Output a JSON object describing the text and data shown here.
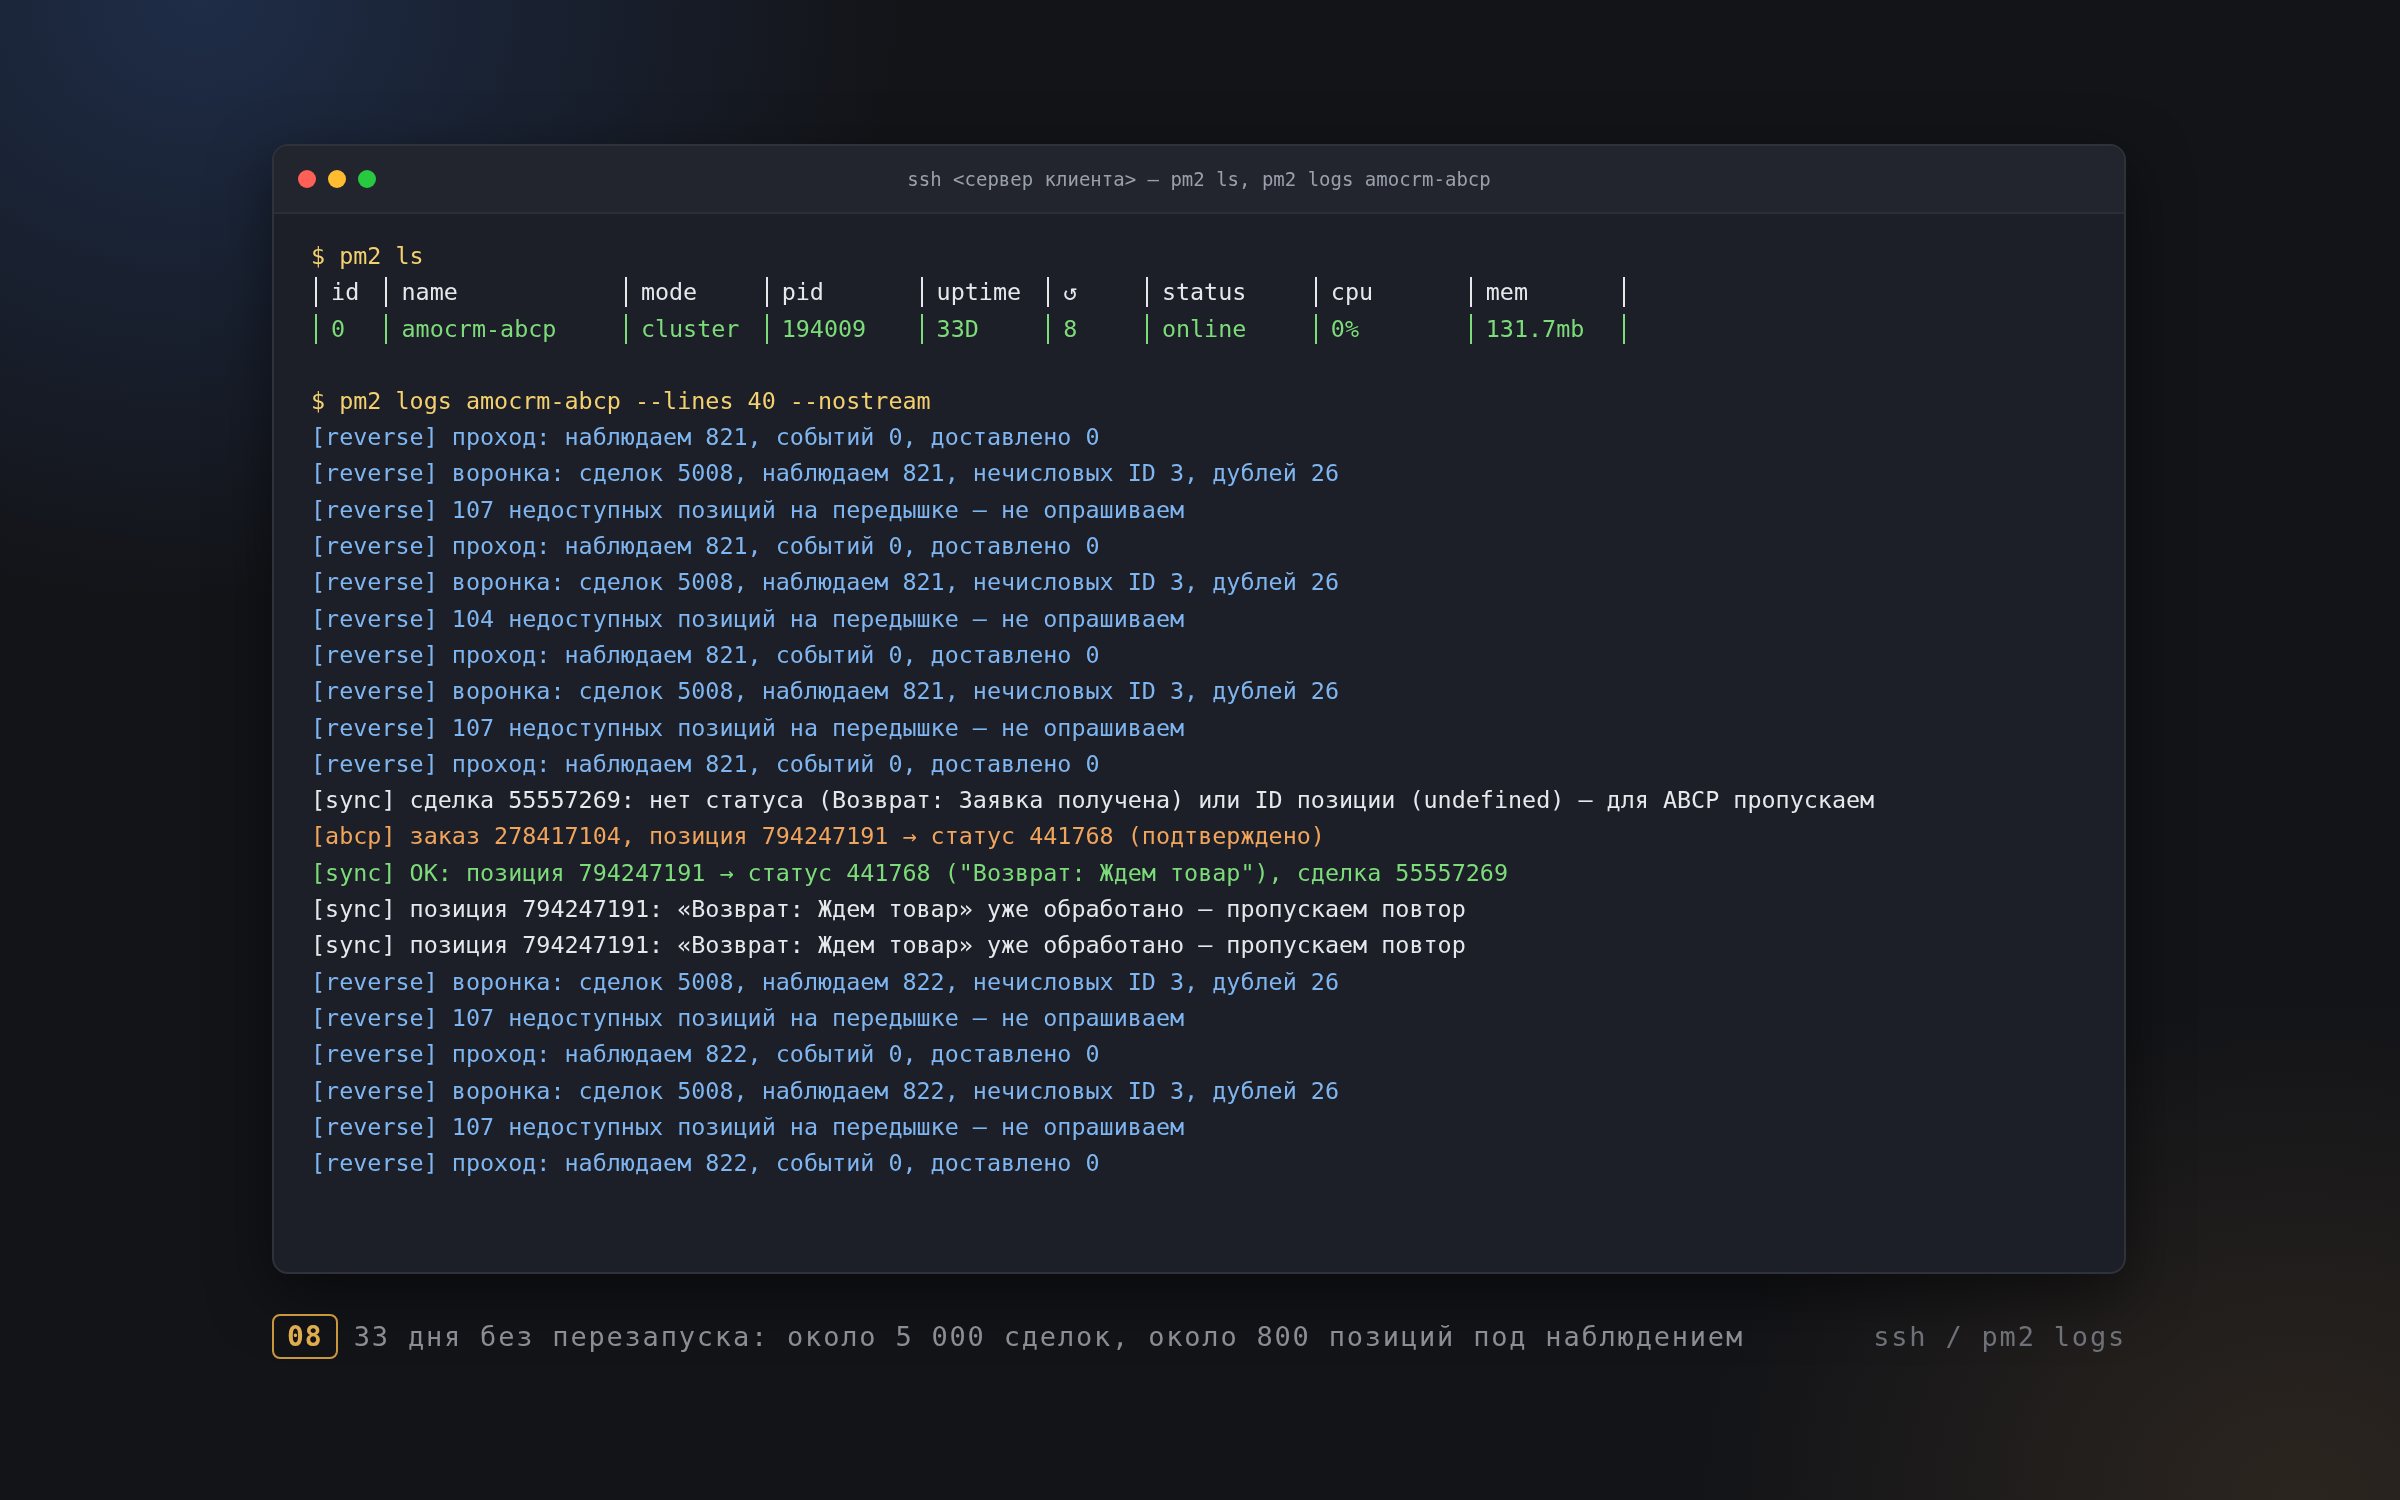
{
  "window": {
    "title": "ssh <сервер клиента> — pm2 ls, pm2 logs amocrm-abcp"
  },
  "terminal": {
    "blocks": [
      {
        "command": "$ pm2 ls",
        "table": {
          "columns": [
            "id",
            "name",
            "mode",
            "pid",
            "uptime",
            "↺",
            "status",
            "cpu",
            "mem"
          ],
          "rows": [
            [
              "0",
              "amocrm-abcp",
              "cluster",
              "194009",
              "33D",
              "8",
              "online",
              "0%",
              "131.7mb"
            ]
          ]
        }
      },
      {
        "command": "$ pm2 logs amocrm-abcp --lines 40 --nostream",
        "logs": [
          {
            "kind": "info",
            "text": "[reverse] проход: наблюдаем 821, событий 0, доставлено 0"
          },
          {
            "kind": "info",
            "text": "[reverse] воронка: сделок 5008, наблюдаем 821, нечисловых ID 3, дублей 26"
          },
          {
            "kind": "info",
            "text": "[reverse] 107 недоступных позиций на передышке — не опрашиваем"
          },
          {
            "kind": "info",
            "text": "[reverse] проход: наблюдаем 821, событий 0, доставлено 0"
          },
          {
            "kind": "info",
            "text": "[reverse] воронка: сделок 5008, наблюдаем 821, нечисловых ID 3, дублей 26"
          },
          {
            "kind": "info",
            "text": "[reverse] 104 недоступных позиций на передышке — не опрашиваем"
          },
          {
            "kind": "info",
            "text": "[reverse] проход: наблюдаем 821, событий 0, доставлено 0"
          },
          {
            "kind": "info",
            "text": "[reverse] воронка: сделок 5008, наблюдаем 821, нечисловых ID 3, дублей 26"
          },
          {
            "kind": "info",
            "text": "[reverse] 107 недоступных позиций на передышке — не опрашиваем"
          },
          {
            "kind": "info",
            "text": "[reverse] проход: наблюдаем 821, событий 0, доставлено 0"
          },
          {
            "kind": "plain",
            "text": "[sync] сделка 55557269: нет статуса (Возврат: Заявка получена) или ID позиции (undefined) — для ABCP пропускаем"
          },
          {
            "kind": "warn",
            "text": "[abcp] заказ 278417104, позиция 794247191 → статус 441768 (подтверждено)"
          },
          {
            "kind": "success",
            "text": "[sync] OK: позиция 794247191 → статус 441768 (\"Возврат: Ждем товар\"), сделка 55557269"
          },
          {
            "kind": "plain",
            "text": "[sync] позиция 794247191: «Возврат: Ждем товар» уже обработано — пропускаем повтор"
          },
          {
            "kind": "plain",
            "text": "[sync] позиция 794247191: «Возврат: Ждем товар» уже обработано — пропускаем повтор"
          },
          {
            "kind": "info",
            "text": "[reverse] воронка: сделок 5008, наблюдаем 822, нечисловых ID 3, дублей 26"
          },
          {
            "kind": "info",
            "text": "[reverse] 107 недоступных позиций на передышке — не опрашиваем"
          },
          {
            "kind": "info",
            "text": "[reverse] проход: наблюдаем 822, событий 0, доставлено 0"
          },
          {
            "kind": "info",
            "text": "[reverse] воронка: сделок 5008, наблюдаем 822, нечисловых ID 3, дублей 26"
          },
          {
            "kind": "info",
            "text": "[reverse] 107 недоступных позиций на передышке — не опрашиваем"
          },
          {
            "kind": "info",
            "text": "[reverse] проход: наблюдаем 822, событий 0, доставлено 0"
          }
        ]
      }
    ]
  },
  "caption": {
    "number": "08",
    "text": "33 дня без перезапуска: около 5 000 сделок, около 800 позиций под наблюдением",
    "source": "ssh / pm2 logs"
  }
}
